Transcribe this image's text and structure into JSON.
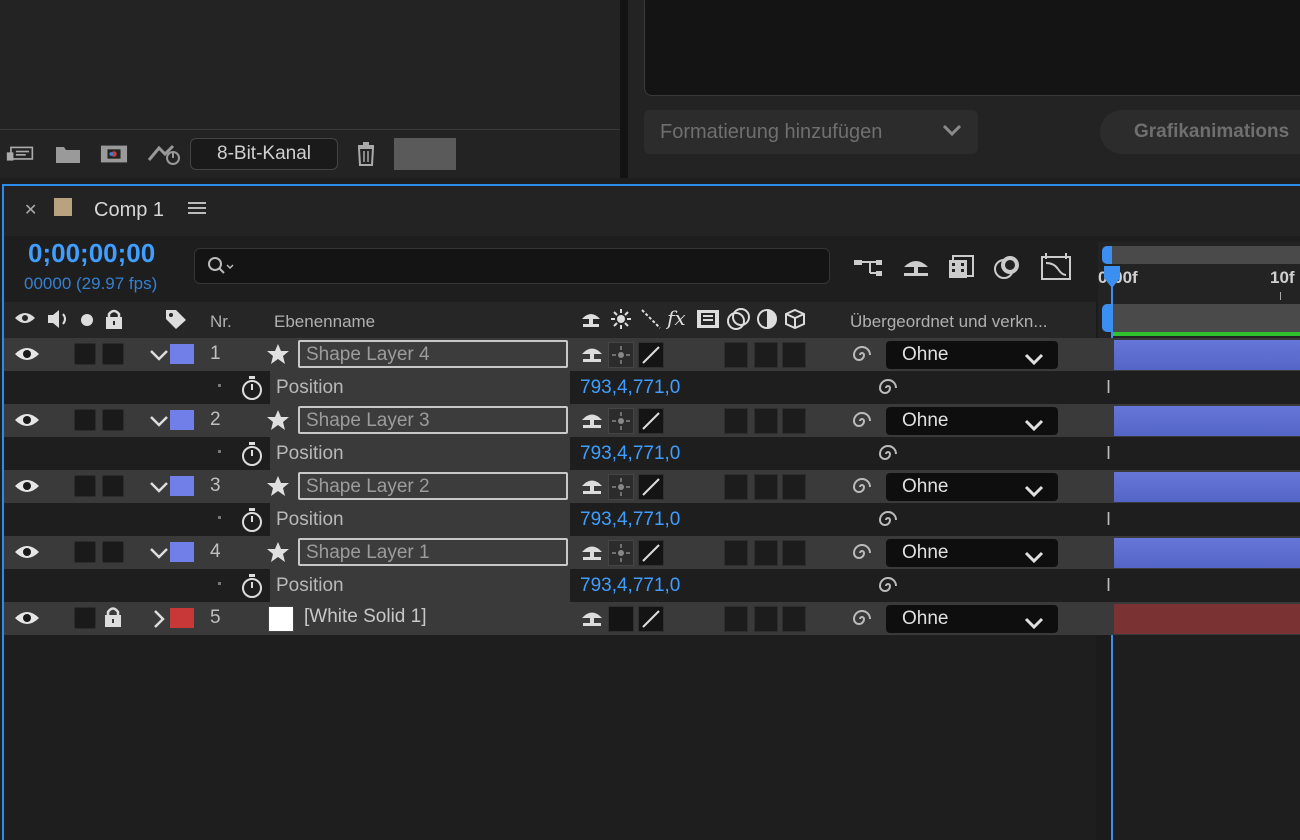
{
  "project": {
    "bit_depth": "8-Bit-Kanal",
    "toolbar_icons": [
      "interpret-footage-icon",
      "new-folder-icon",
      "new-composition-icon",
      "flowchart-icon",
      "delete-icon"
    ]
  },
  "essential_graphics": {
    "add_format_label": "Formatierung hinzufügen",
    "motion_graphics_label": "Grafikanimations"
  },
  "comp": {
    "tab_title": "Comp 1",
    "timecode": "0;00;00;00",
    "timecode_sub": "00000 (29.97 fps)",
    "search_placeholder": ""
  },
  "columns": {
    "nr": "Nr.",
    "layer_name": "Ebenenname",
    "parent": "Übergeordnet und verkn..."
  },
  "ruler": {
    "start_label": "0:00f",
    "tick_label": "10f"
  },
  "layers": [
    {
      "nr": "1",
      "name": "Shape Layer 4",
      "parent": "Ohne",
      "property": "Position",
      "value": "793,4,771,0",
      "label_color": "#7080e8"
    },
    {
      "nr": "2",
      "name": "Shape Layer 3",
      "parent": "Ohne",
      "property": "Position",
      "value": "793,4,771,0",
      "label_color": "#7080e8"
    },
    {
      "nr": "3",
      "name": "Shape Layer 2",
      "parent": "Ohne",
      "property": "Position",
      "value": "793,4,771,0",
      "label_color": "#7080e8"
    },
    {
      "nr": "4",
      "name": "Shape Layer 1",
      "parent": "Ohne",
      "property": "Position",
      "value": "793,4,771,0",
      "label_color": "#7080e8"
    },
    {
      "nr": "5",
      "name": "[White Solid 1]",
      "parent": "Ohne",
      "label_color": "#c83838"
    }
  ],
  "colors": {
    "accent": "#2d8ceb",
    "timecode": "#3f9eff",
    "shape_bar": "#5a6bd0",
    "solid_bar": "#7a3232",
    "work_area_green": "#2fc22f"
  }
}
